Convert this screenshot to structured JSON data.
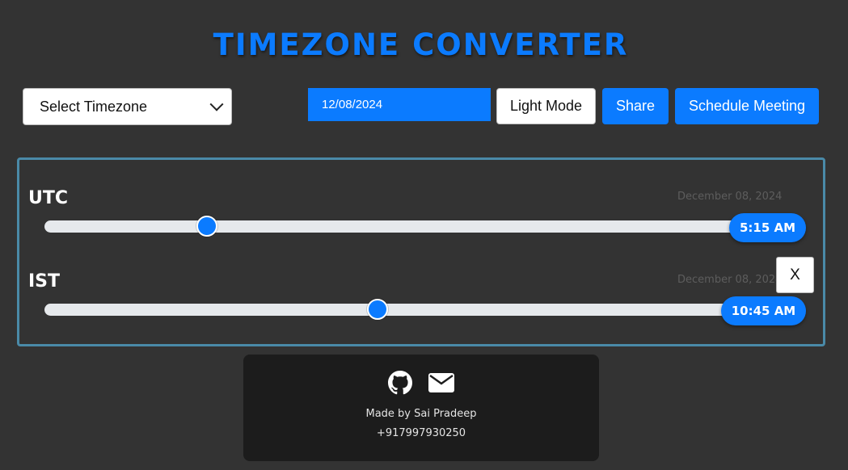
{
  "app": {
    "title": "TIMEZONE CONVERTER"
  },
  "toolbar": {
    "timezone_select_value": "Select Timezone",
    "date_value": "12/08/2024",
    "light_mode_label": "Light Mode",
    "share_label": "Share",
    "schedule_label": "Schedule Meeting"
  },
  "timezones": [
    {
      "name": "UTC",
      "date": "December 08, 2024",
      "time": "5:15 AM",
      "slider_fraction": 0.22
    },
    {
      "name": "IST",
      "date": "December 08, 2024",
      "time": "10:45 AM",
      "slider_fraction": 0.45,
      "remove_label": "X"
    }
  ],
  "footer": {
    "icons": [
      "github-icon",
      "mail-icon"
    ],
    "made_by": "Made by Sai Pradeep",
    "phone": "+917997930250"
  },
  "colors": {
    "accent": "#0b7bff",
    "background": "#333333",
    "panel_border": "#4a8aa8",
    "footer_bg": "#1c1c1c"
  }
}
